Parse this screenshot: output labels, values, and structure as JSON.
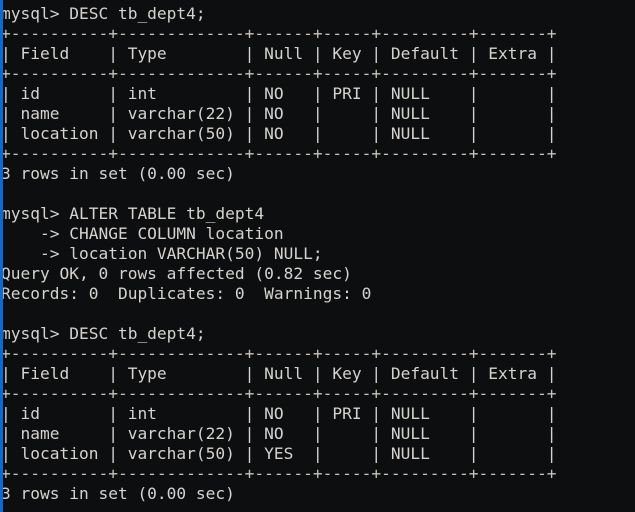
{
  "terminal": {
    "title": "mysql",
    "prompt": "mysql>",
    "continuation_prompt": "->",
    "background_color": "#0d0e10",
    "text_color": "#d6d3ce",
    "scrollbar_color": "#1668c4",
    "cols": 64,
    "rows": 26
  },
  "session": {
    "table_name": "tb_dept4",
    "commands": [
      "DESC tb_dept4;",
      "ALTER TABLE tb_dept4",
      "CHANGE COLUMN location",
      "location VARCHAR(50) NULL;",
      "DESC tb_dept4;"
    ],
    "status_messages": [
      "3 rows in set (0.00 sec)",
      "Query OK, 0 rows affected (0.82 sec)",
      "Records: 0  Duplicates: 0  Warnings: 0",
      "3 rows in set (0.00 sec)"
    ],
    "describe_columns": [
      "Field",
      "Type",
      "Null",
      "Key",
      "Default",
      "Extra"
    ],
    "describe_before": [
      [
        "id",
        "int",
        "NO",
        "PRI",
        "NULL",
        ""
      ],
      [
        "name",
        "varchar(22)",
        "NO",
        "",
        "NULL",
        ""
      ],
      [
        "location",
        "varchar(50)",
        "NO",
        "",
        "NULL",
        ""
      ]
    ],
    "describe_after": [
      [
        "id",
        "int",
        "NO",
        "PRI",
        "NULL",
        ""
      ],
      [
        "name",
        "varchar(22)",
        "NO",
        "",
        "NULL",
        ""
      ],
      [
        "location",
        "varchar(50)",
        "YES",
        "",
        "NULL",
        ""
      ]
    ]
  },
  "lines": [
    {
      "id": "l01",
      "kind": "prompt",
      "text": "mysql> DESC tb_dept4;"
    },
    {
      "id": "l02",
      "kind": "rule",
      "text": "+----------+-------------+------+-----+---------+-------+"
    },
    {
      "id": "l03",
      "kind": "header",
      "text": "| Field    | Type        | Null | Key | Default | Extra |"
    },
    {
      "id": "l04",
      "kind": "rule",
      "text": "+----------+-------------+------+-----+---------+-------+"
    },
    {
      "id": "l05",
      "kind": "data",
      "text": "| id       | int         | NO   | PRI | NULL    |       |"
    },
    {
      "id": "l06",
      "kind": "data",
      "text": "| name     | varchar(22) | NO   |     | NULL    |       |"
    },
    {
      "id": "l07",
      "kind": "data",
      "text": "| location | varchar(50) | NO   |     | NULL    |       |"
    },
    {
      "id": "l08",
      "kind": "rule",
      "text": "+----------+-------------+------+-----+---------+-------+"
    },
    {
      "id": "l09",
      "kind": "status",
      "text": "3 rows in set (0.00 sec)"
    },
    {
      "id": "l10",
      "kind": "blank",
      "text": " "
    },
    {
      "id": "l11",
      "kind": "prompt",
      "text": "mysql> ALTER TABLE tb_dept4"
    },
    {
      "id": "l12",
      "kind": "cont",
      "text": "    -> CHANGE COLUMN location"
    },
    {
      "id": "l13",
      "kind": "cont",
      "text": "    -> location VARCHAR(50) NULL;"
    },
    {
      "id": "l14",
      "kind": "status",
      "text": "Query OK, 0 rows affected (0.82 sec)"
    },
    {
      "id": "l15",
      "kind": "status",
      "text": "Records: 0  Duplicates: 0  Warnings: 0"
    },
    {
      "id": "l16",
      "kind": "blank",
      "text": " "
    },
    {
      "id": "l17",
      "kind": "prompt",
      "text": "mysql> DESC tb_dept4;"
    },
    {
      "id": "l18",
      "kind": "rule",
      "text": "+----------+-------------+------+-----+---------+-------+"
    },
    {
      "id": "l19",
      "kind": "header",
      "text": "| Field    | Type        | Null | Key | Default | Extra |"
    },
    {
      "id": "l20",
      "kind": "rule",
      "text": "+----------+-------------+------+-----+---------+-------+"
    },
    {
      "id": "l21",
      "kind": "data",
      "text": "| id       | int         | NO   | PRI | NULL    |       |"
    },
    {
      "id": "l22",
      "kind": "data",
      "text": "| name     | varchar(22) | NO   |     | NULL    |       |"
    },
    {
      "id": "l23",
      "kind": "data",
      "text": "| location | varchar(50) | YES  |     | NULL    |       |"
    },
    {
      "id": "l24",
      "kind": "rule",
      "text": "+----------+-------------+------+-----+---------+-------+"
    },
    {
      "id": "l25",
      "kind": "status",
      "text": "3 rows in set (0.00 sec)"
    }
  ]
}
